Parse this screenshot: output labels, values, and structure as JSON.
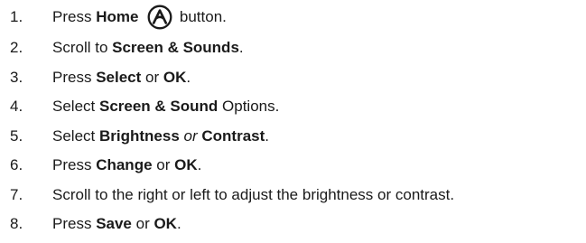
{
  "steps": [
    {
      "num": "1.",
      "parts": [
        {
          "t": "Press ",
          "s": "n"
        },
        {
          "t": "Home",
          "s": "b"
        },
        {
          "t": " ",
          "s": "n"
        },
        {
          "icon": "home-button-icon",
          "label": "A"
        },
        {
          "t": " button.",
          "s": "n"
        }
      ]
    },
    {
      "num": "2.",
      "parts": [
        {
          "t": "Scroll to ",
          "s": "n"
        },
        {
          "t": "Screen & Sounds",
          "s": "b"
        },
        {
          "t": ".",
          "s": "n"
        }
      ]
    },
    {
      "num": "3.",
      "parts": [
        {
          "t": "Press ",
          "s": "n"
        },
        {
          "t": "Select",
          "s": "b"
        },
        {
          "t": " or ",
          "s": "n"
        },
        {
          "t": "OK",
          "s": "b"
        },
        {
          "t": ".",
          "s": "n"
        }
      ]
    },
    {
      "num": "4.",
      "parts": [
        {
          "t": "Select ",
          "s": "n"
        },
        {
          "t": "Screen & Sound",
          "s": "b"
        },
        {
          "t": " Options.",
          "s": "n"
        }
      ]
    },
    {
      "num": "5.",
      "parts": [
        {
          "t": "Select ",
          "s": "n"
        },
        {
          "t": "Brightness",
          "s": "b"
        },
        {
          "t": " ",
          "s": "n"
        },
        {
          "t": "or",
          "s": "i"
        },
        {
          "t": " ",
          "s": "n"
        },
        {
          "t": "Contrast",
          "s": "b"
        },
        {
          "t": ".",
          "s": "n"
        }
      ]
    },
    {
      "num": "6.",
      "parts": [
        {
          "t": "Press ",
          "s": "n"
        },
        {
          "t": "Change",
          "s": "b"
        },
        {
          "t": " or ",
          "s": "n"
        },
        {
          "t": "OK",
          "s": "b"
        },
        {
          "t": ".",
          "s": "n"
        }
      ]
    },
    {
      "num": "7.",
      "parts": [
        {
          "t": "Scroll to the right or left to adjust the brightness or contrast.",
          "s": "n"
        }
      ]
    },
    {
      "num": "8.",
      "parts": [
        {
          "t": "Press ",
          "s": "n"
        },
        {
          "t": "Save",
          "s": "b"
        },
        {
          "t": " or ",
          "s": "n"
        },
        {
          "t": "OK",
          "s": "b"
        },
        {
          "t": ".",
          "s": "n"
        }
      ]
    }
  ]
}
